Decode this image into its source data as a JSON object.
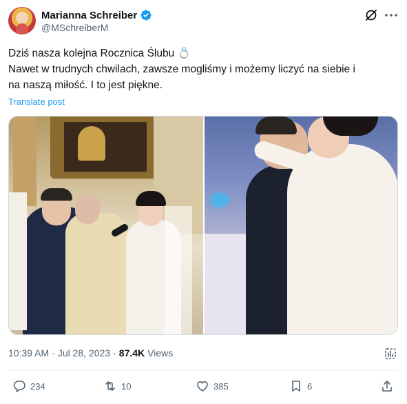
{
  "author": {
    "name": "Marianna Schreiber",
    "handle": "@MSchreiberM"
  },
  "tweet": {
    "line1": "Dziś nasza kolejna Rocznica Ślubu 💍",
    "line2": "Nawet w trudnych chwilach, zawsze mogliśmy i możemy liczyć na siebie i",
    "line3": "na naszą miłość. I to jest piękne.",
    "translate_label": "Translate post"
  },
  "meta": {
    "time": "10:39 AM",
    "separator1": "·",
    "date": "Jul 28, 2023",
    "separator2": "·",
    "views_count": "87.4K",
    "views_label": "Views"
  },
  "actions": {
    "replies": "234",
    "reposts": "10",
    "likes": "385",
    "bookmarks": "6"
  },
  "icons": {
    "verified": "verified-badge-icon",
    "grok": "grok-icon",
    "more": "more-dots-icon",
    "analytics": "analytics-icon",
    "reply": "reply-icon",
    "repost": "repost-icon",
    "like": "heart-icon",
    "bookmark": "bookmark-icon",
    "share": "share-icon"
  },
  "colors": {
    "accent": "#1d9bf0",
    "text": "#0f1419",
    "secondary": "#536471"
  }
}
